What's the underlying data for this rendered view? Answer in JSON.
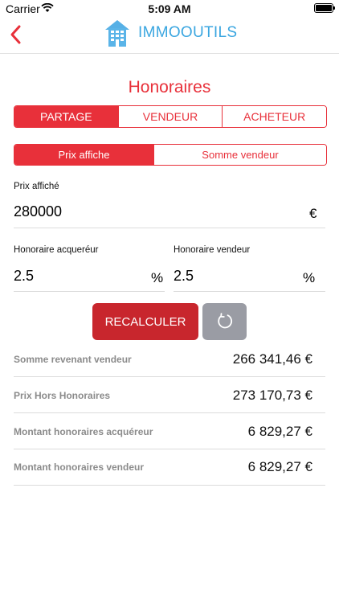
{
  "status": {
    "carrier": "Carrier",
    "time": "5:09 AM"
  },
  "header": {
    "brand": "IMMOOUTILS"
  },
  "page": {
    "title": "Honoraires"
  },
  "tabs": [
    {
      "label": "PARTAGE",
      "active": true
    },
    {
      "label": "VENDEUR",
      "active": false
    },
    {
      "label": "ACHETEUR",
      "active": false
    }
  ],
  "mode": [
    {
      "label": "Prix affiche",
      "active": true
    },
    {
      "label": "Somme vendeur",
      "active": false
    }
  ],
  "form": {
    "prix_label": "Prix affiché",
    "prix_value": "280000",
    "prix_unit": "€",
    "acq_label": "Honoraire acqueréur",
    "acq_value": "2.5",
    "acq_unit": "%",
    "vend_label": "Honoraire vendeur",
    "vend_value": "2.5",
    "vend_unit": "%"
  },
  "actions": {
    "recalc_label": "RECALCULER"
  },
  "results": [
    {
      "label": "Somme revenant vendeur",
      "value": "266 341,46 €"
    },
    {
      "label": "Prix Hors Honoraires",
      "value": "273 170,73 €"
    },
    {
      "label": "Montant honoraires acquéreur",
      "value": "6 829,27 €"
    },
    {
      "label": "Montant honoraires vendeur",
      "value": "6 829,27 €"
    }
  ],
  "colors": {
    "accent": "#e8303a",
    "button": "#c8262d",
    "reset": "#9a9ca4",
    "brand": "#3aa6e0"
  }
}
